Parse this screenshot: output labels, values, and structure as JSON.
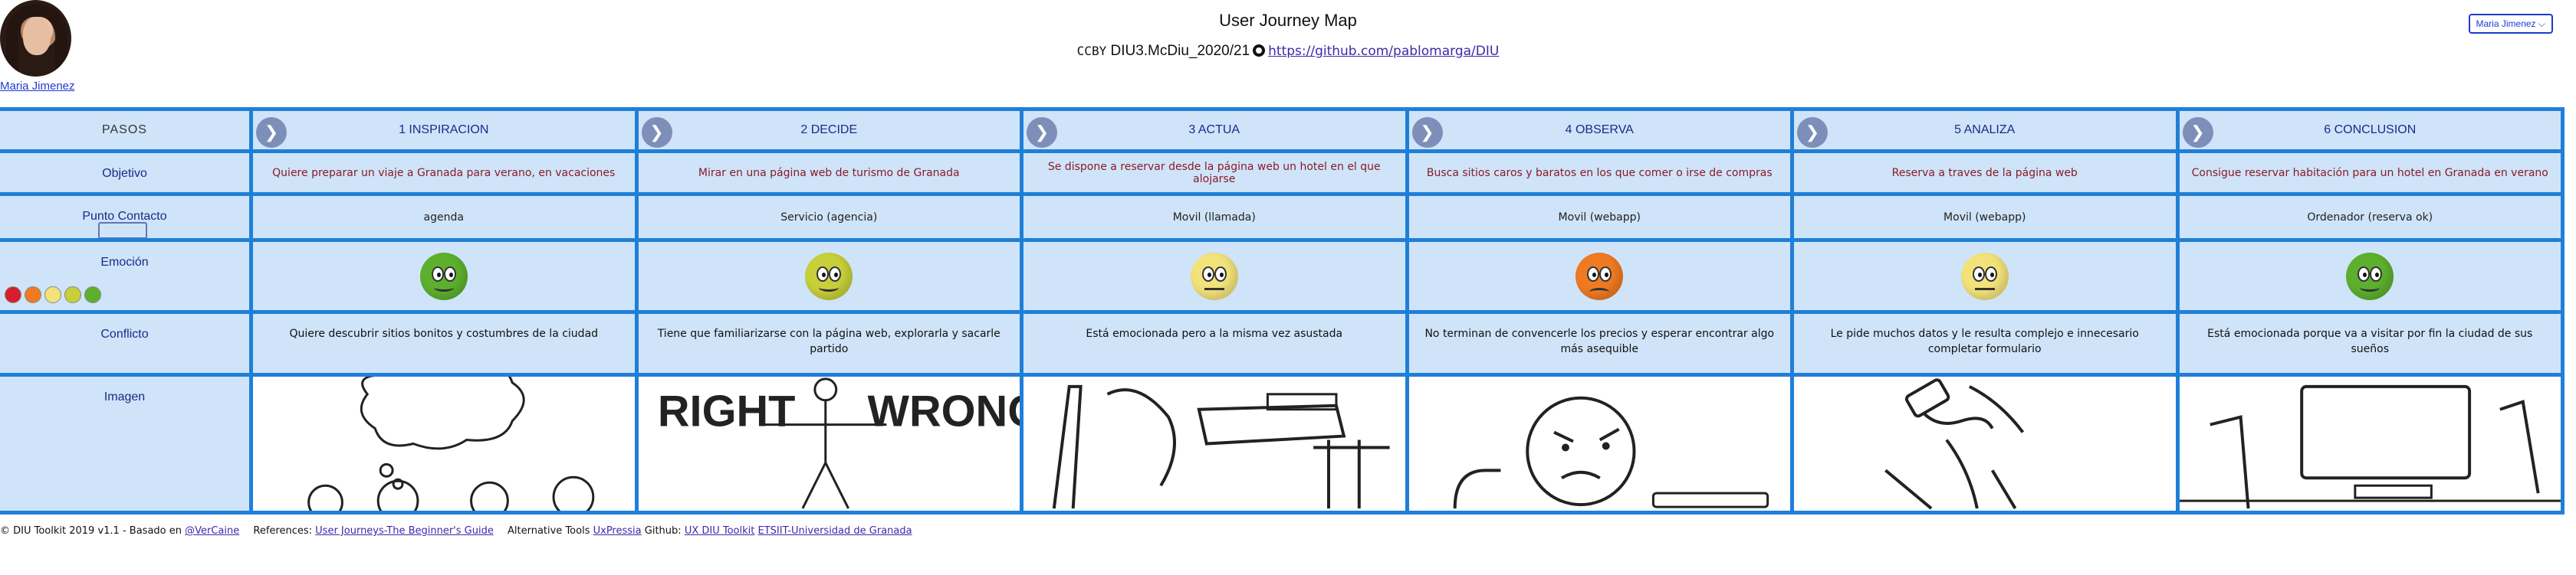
{
  "header": {
    "title": "User Journey Map",
    "cc_text": "CCBY",
    "course": "DIU3.McDiu_2020/21",
    "repo_link": "https://github.com/pablomarga/DIU",
    "user_name": "Maria Jimenez",
    "user_select_value": "Maria Jimenez"
  },
  "row_labels": {
    "steps": "PASOS",
    "objective": "Objetivo",
    "contact": "Punto Contacto",
    "emotion": "Emoción",
    "conflict": "Conflicto",
    "image": "Imagen"
  },
  "steps": [
    {
      "title": "1 INSPIRACION",
      "objective": "Quiere preparar un viaje a Granada para verano, en vacaciones",
      "contact": "agenda",
      "emotion": "happy",
      "conflict": "Quiere descubrir sitios bonitos y costumbres de la ciudad",
      "image": "thinking-people-sketch"
    },
    {
      "title": "2 DECIDE",
      "objective": "Mirar en una página web de turismo de Granada",
      "contact": "Servicio (agencia)",
      "emotion": "neutral-happy",
      "conflict": "Tiene que familiarizarse con la página web, explorarla y sacarle partido",
      "image": "right-wrong-sketch"
    },
    {
      "title": "3 ACTUA",
      "objective": "Se dispone a reservar desde la página web un hotel en el que alojarse",
      "contact": "Movil (llamada)",
      "emotion": "neutral",
      "conflict": "Está emocionada pero a la misma vez asustada",
      "image": "computer-desk-sketch"
    },
    {
      "title": "4 OBSERVA",
      "objective": "Busca sitios caros y baratos en los que comer o irse de compras",
      "contact": "Movil (webapp)",
      "emotion": "upset",
      "conflict": "No terminan de convencerle los precios y esperar encontrar algo más asequible",
      "image": "angry-face-sketch"
    },
    {
      "title": "5 ANALIZA",
      "objective": "Reserva a traves de la página web",
      "contact": "Movil (webapp)",
      "emotion": "neutral",
      "conflict": "Le pide muchos datos y le resulta complejo e innecesario completar formulario",
      "image": "phone-hand-sketch"
    },
    {
      "title": "6 CONCLUSION",
      "objective": "Consigue reservar habitación para un hotel en Granada en verano",
      "contact": "Ordenador (reserva ok)",
      "emotion": "happy",
      "conflict": "Está emocionada porque va a visitar por fin la ciudad de sus sueños",
      "image": "monitor-desk-sketch"
    }
  ],
  "emotion_colors": {
    "happy": "#5db02e",
    "neutral-happy": "#c7cf3a",
    "neutral": "#f2e27a",
    "upset": "#f07a22",
    "angry": "#d81e2a"
  },
  "mini_scale_colors": [
    "#d81e2a",
    "#f07a22",
    "#f2e27a",
    "#c7cf3a",
    "#5db02e"
  ],
  "footer": {
    "credit": "© DIU Toolkit 2019 v1.1 - Basado en",
    "credit_link": "@VerCaine",
    "references_label": "References:",
    "references_link": "User Journeys-The Beginner's Guide",
    "alt_tools_label": "Alternative Tools",
    "alt_tools_link": "UxPressia",
    "github_label": "Github:",
    "github_link": "UX DIU Toolkit",
    "university_link": "ETSIIT-Universidad de Granada"
  }
}
